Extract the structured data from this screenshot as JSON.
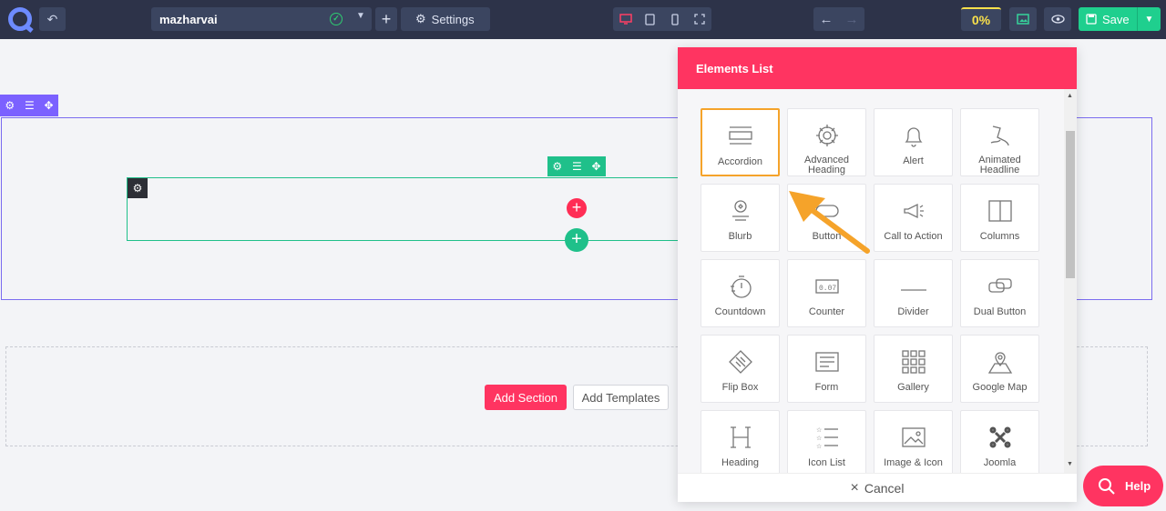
{
  "topbar": {
    "site_name": "mazharvai",
    "settings_label": "Settings",
    "progress_label": "0%",
    "save_label": "Save"
  },
  "canvas": {
    "add_section_label": "Add Section",
    "add_templates_label": "Add Templates"
  },
  "panel": {
    "title": "Elements List",
    "cancel_label": "Cancel",
    "elements": [
      {
        "label": "Accordion",
        "icon": "accordion-icon"
      },
      {
        "label": "Advanced Heading",
        "icon": "gear-puzzle-icon"
      },
      {
        "label": "Alert",
        "icon": "bell-icon"
      },
      {
        "label": "Animated Headline",
        "icon": "animated-headline-icon"
      },
      {
        "label": "Blurb",
        "icon": "blurb-icon"
      },
      {
        "label": "Button",
        "icon": "button-icon"
      },
      {
        "label": "Call to Action",
        "icon": "megaphone-icon"
      },
      {
        "label": "Columns",
        "icon": "columns-icon"
      },
      {
        "label": "Countdown",
        "icon": "stopwatch-icon"
      },
      {
        "label": "Counter",
        "icon": "counter-icon"
      },
      {
        "label": "Divider",
        "icon": "divider-icon"
      },
      {
        "label": "Dual Button",
        "icon": "dual-button-icon"
      },
      {
        "label": "Flip Box",
        "icon": "flip-box-icon"
      },
      {
        "label": "Form",
        "icon": "form-icon"
      },
      {
        "label": "Gallery",
        "icon": "gallery-icon"
      },
      {
        "label": "Google Map",
        "icon": "map-icon"
      },
      {
        "label": "Heading",
        "icon": "heading-icon"
      },
      {
        "label": "Icon List",
        "icon": "icon-list-icon"
      },
      {
        "label": "Image & Icon",
        "icon": "image-icon"
      },
      {
        "label": "Joomla",
        "icon": "joomla-icon"
      }
    ]
  },
  "help_label": "Help"
}
